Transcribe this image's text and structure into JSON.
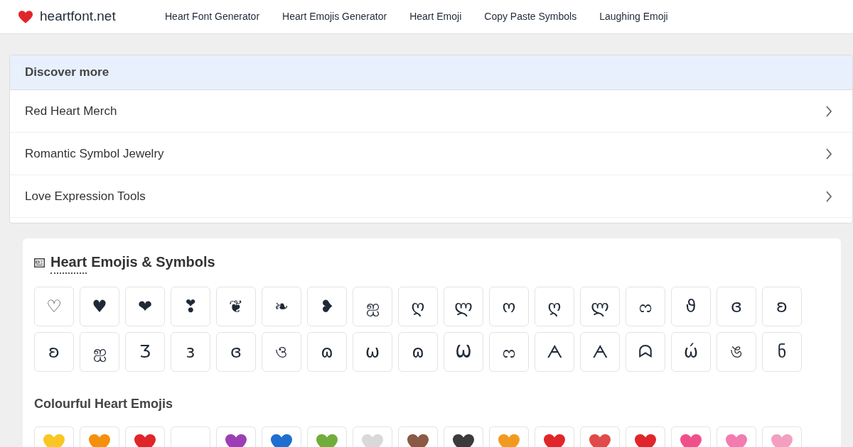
{
  "site": {
    "name": "heartfont.net"
  },
  "nav": [
    "Heart Font Generator",
    "Heart Emojis Generator",
    "Heart Emoji",
    "Copy Paste Symbols",
    "Laughing Emoji"
  ],
  "discover": {
    "title": "Discover more",
    "items": [
      "Red Heart Merch",
      "Romantic Symbol Jewelry",
      "Love Expression Tools"
    ]
  },
  "section": {
    "title_link": "Heart",
    "title_rest": "Emojis & Symbols",
    "symbols": [
      "♡",
      "♥",
      "❤",
      "❣",
      "❦",
      "❧",
      "❥",
      "ஐ",
      "ღ",
      "ლ",
      "ო",
      "ღ",
      "ლ",
      "ᦂ",
      "ϑ",
      "ɞ",
      "ʚ",
      "ʚ",
      "ஐ",
      "Ʒ",
      "з",
      "ɞ",
      "ও",
      "ɷ",
      "ω",
      "ɷ",
      "Ѡ",
      "ᦂ",
      "ᗅ",
      "ᗅ",
      "ᗣ",
      "ώ",
      "ঙ",
      "ნ"
    ],
    "subtitle": "Colourful Heart Emojis",
    "emojis": [
      {
        "color": "#f9c623"
      },
      {
        "color": "#f5900c"
      },
      {
        "color": "#e0262b"
      },
      {
        "kind": "blank"
      },
      {
        "color": "#9c3fb7"
      },
      {
        "color": "#1e6fd0"
      },
      {
        "color": "#72ad3b"
      },
      {
        "color": "#d9d9d9"
      },
      {
        "color": "#8a5a44"
      },
      {
        "color": "#3b3b3b"
      },
      {
        "color": "#f29a1f"
      },
      {
        "color": "#e0262b"
      },
      {
        "color": "#e04a4a"
      },
      {
        "color": "#e0262b"
      },
      {
        "color": "#f0508a"
      },
      {
        "color": "#f27bb0"
      },
      {
        "color": "#f3a0c0"
      }
    ]
  }
}
